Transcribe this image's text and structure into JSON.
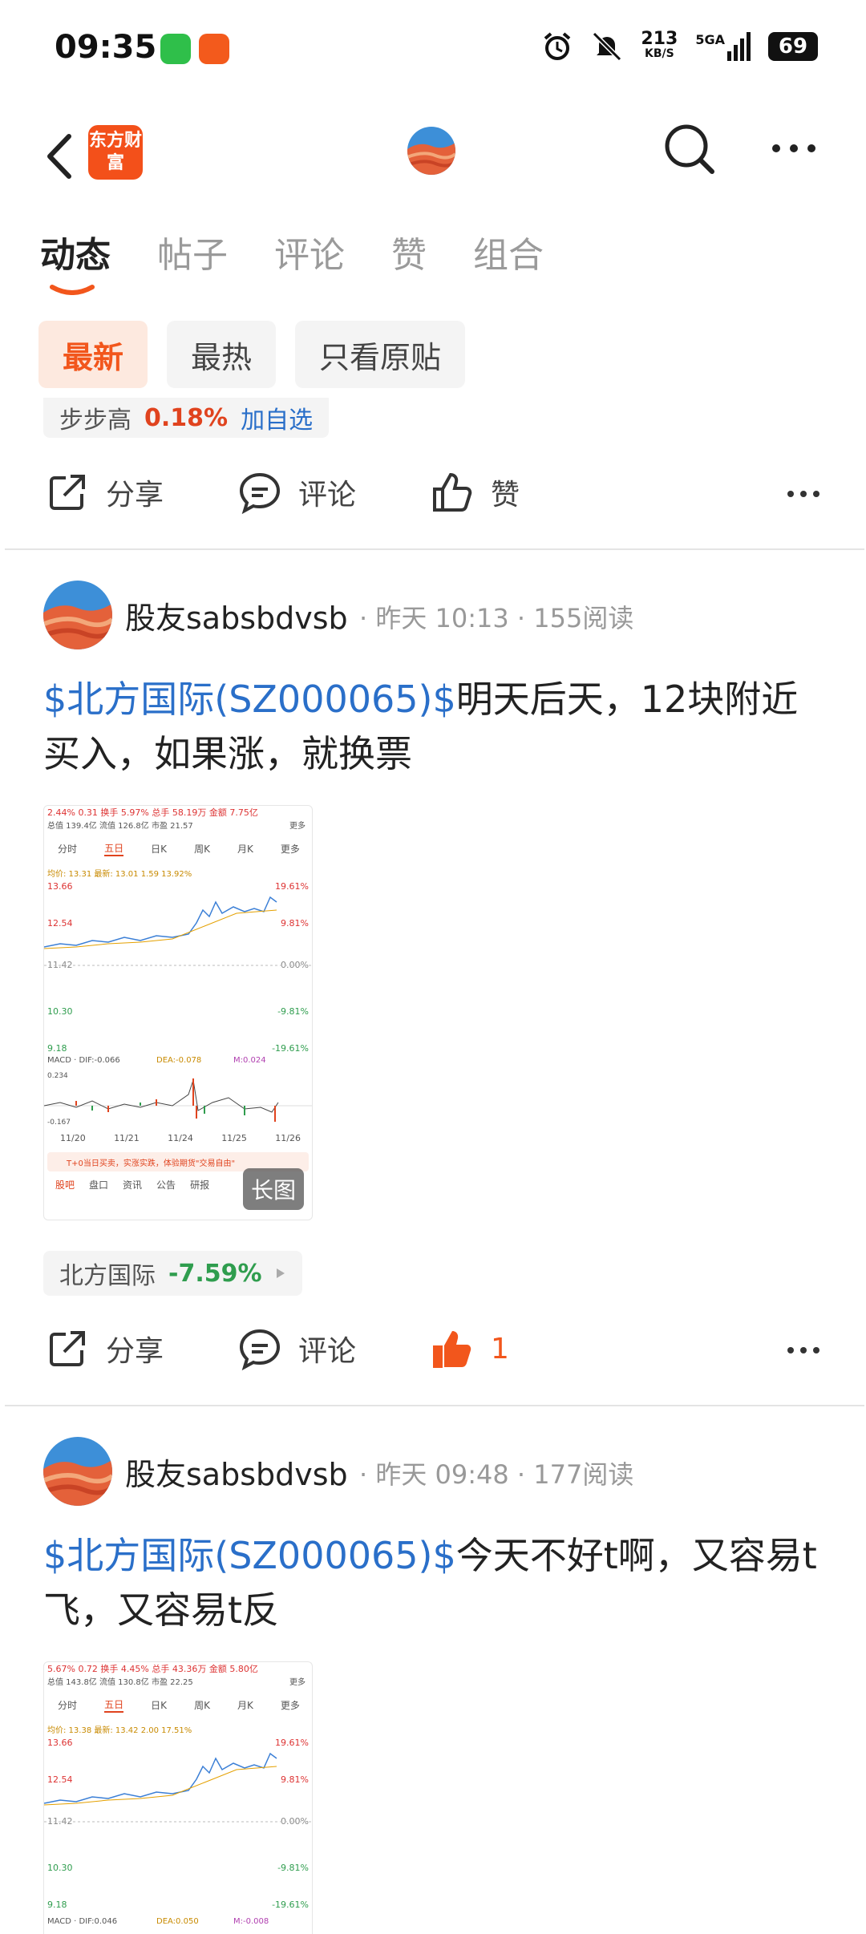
{
  "status_bar": {
    "time": "09:35",
    "net_speed": "213",
    "net_unit": "KB/S",
    "signal": "5GA",
    "battery": "69"
  },
  "header": {
    "logo_text": "东方财富"
  },
  "tabs": [
    {
      "label": "动态",
      "active": true
    },
    {
      "label": "帖子",
      "active": false
    },
    {
      "label": "评论",
      "active": false
    },
    {
      "label": "赞",
      "active": false
    },
    {
      "label": "组合",
      "active": false
    }
  ],
  "filters": [
    {
      "label": "最新",
      "active": true
    },
    {
      "label": "最热",
      "active": false
    },
    {
      "label": "只看原贴",
      "active": false
    }
  ],
  "prev_post": {
    "stock_name": "步步高",
    "stock_pct": "0.18%",
    "add_label": "加自选"
  },
  "actions": {
    "share": "分享",
    "comment": "评论",
    "like": "赞"
  },
  "posts": [
    {
      "user": "股友sabsbdvsb",
      "meta": "· 昨天 10:13 · 155阅读",
      "link": "$北方国际(SZ000065)$",
      "text": "明天后天，12块附近买入，如果涨，就换票",
      "chart": {
        "top_line": "2.44%  0.31  换手 5.97%  总手 58.19万  金额 7.75亿",
        "line2": "总值 139.4亿  流值 126.8亿  市盈 21.57",
        "more": "更多",
        "periods": [
          "分时",
          "五日",
          "日K",
          "周K",
          "月K",
          "更多"
        ],
        "avg_line": "均价: 13.31  最新: 13.01  1.59  13.92%",
        "left_ticks": [
          "13.66",
          "12.54",
          "11.42",
          "10.30",
          "9.18"
        ],
        "right_ticks": [
          "19.61%",
          "9.81%",
          "0.00%",
          "-9.81%",
          "-19.61%"
        ],
        "macd": "MACD · DIF:-0.066",
        "dea": "DEA:-0.078",
        "m": "M:0.024",
        "macd_top": "0.234",
        "macd_bottom": "-0.167",
        "dates": [
          "11/20",
          "11/21",
          "11/24",
          "11/25",
          "11/26"
        ],
        "banner": "T+0当日买卖，实涨实跌，体验期货\"交易自由\"",
        "bottom_tabs": [
          "股吧",
          "盘口",
          "资讯",
          "公告",
          "研报"
        ],
        "badge": "长图"
      },
      "stock_name": "北方国际",
      "stock_pct": "-7.59%",
      "likes": "1"
    },
    {
      "user": "股友sabsbdvsb",
      "meta": "· 昨天 09:48 · 177阅读",
      "link": "$北方国际(SZ000065)$",
      "text": "今天不好t啊，又容易t飞，又容易t反",
      "chart": {
        "top_line": "5.67%  0.72  换手 4.45%  总手 43.36万  金额 5.80亿",
        "line2": "总值 143.8亿  流值 130.8亿  市盈 22.25",
        "more": "更多",
        "periods": [
          "分时",
          "五日",
          "日K",
          "周K",
          "月K",
          "更多"
        ],
        "avg_line": "均价: 13.38  最新: 13.42  2.00  17.51%",
        "left_ticks": [
          "13.66",
          "12.54",
          "11.42",
          "10.30",
          "9.18"
        ],
        "right_ticks": [
          "19.61%",
          "9.81%",
          "0.00%",
          "-9.81%",
          "-19.61%"
        ],
        "macd": "MACD · DIF:0.046",
        "dea": "DEA:0.050",
        "m": "M:-0.008"
      }
    }
  ],
  "colors": {
    "accent": "#f2561c",
    "link": "#2a6fc9",
    "up": "#e0431e",
    "down": "#2f9d4e"
  }
}
